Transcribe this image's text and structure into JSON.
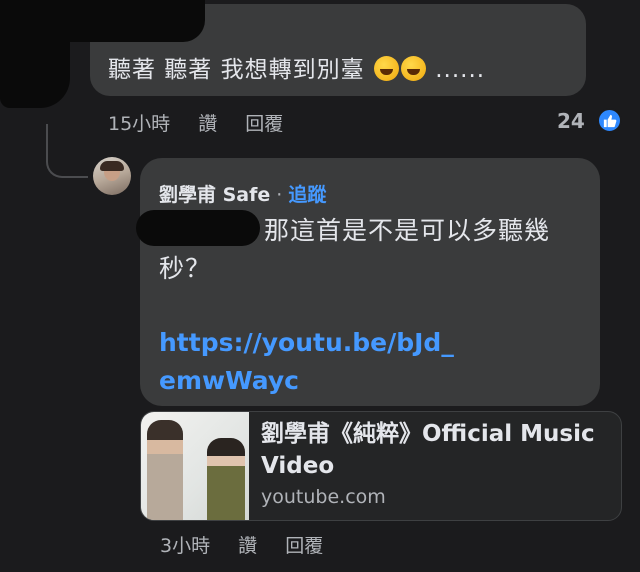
{
  "top_comment": {
    "text": "聽著 聽著 我想轉到別臺",
    "emojis": [
      "rolling-on-floor-laughing-emoji",
      "tears-of-joy-emoji"
    ],
    "trailing": "......",
    "time": "15小時",
    "like_action": "讚",
    "reply_action": "回覆",
    "reaction_count": "24"
  },
  "reply": {
    "author": "劉學甫 Safe",
    "separator": "·",
    "follow_label": "追蹤",
    "text": "那這首是不是可以多聽幾秒？",
    "link": "https://youtu.be/bJd_emwWayc",
    "time": "3小時",
    "like_action": "讚",
    "reply_action": "回覆"
  },
  "link_preview": {
    "title": "劉學甫《純粹》Official Music Video",
    "domain": "youtube.com"
  },
  "colors": {
    "background": "#1b1b1d",
    "bubble": "#3a3b3c",
    "link": "#4599ff",
    "muted_text": "#b0b3b8"
  }
}
